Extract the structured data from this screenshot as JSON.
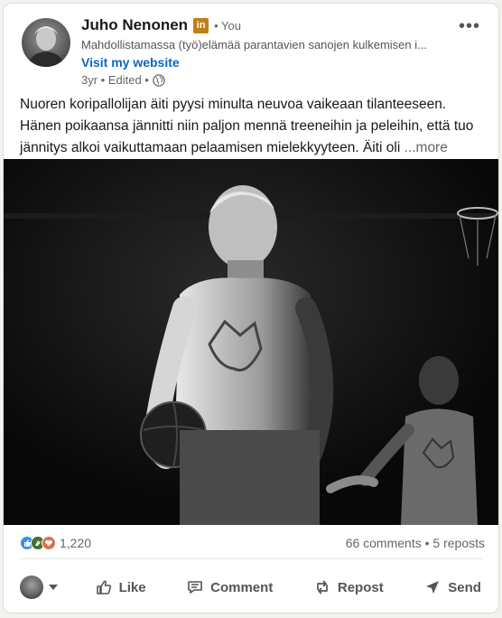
{
  "author": {
    "name": "Juho Nenonen",
    "badge": "in",
    "you_label": "• You",
    "headline": "Mahdollistamassa (työ)elämää parantavien sanojen kulkemisen i...",
    "website_label": "Visit my website",
    "meta": "3yr • Edited •"
  },
  "post": {
    "text": "Nuoren koripallolijan äiti pyysi minulta neuvoa vaikeaan tilanteeseen. Hänen poikaansa jännitti niin paljon mennä treeneihin ja peleihin, että tuo jännitys alkoi vaikuttamaan pelaamisen mielekkyyteen. Äiti oli",
    "see_more": "...more"
  },
  "social": {
    "reaction_count": "1,220",
    "comments_reposts": "66 comments • 5 reposts"
  },
  "actions": {
    "like": "Like",
    "comment": "Comment",
    "repost": "Repost",
    "send": "Send"
  },
  "icons": {
    "menu": "more-horizontal-icon",
    "visibility": "globe-icon",
    "like": "thumbs-up-icon",
    "comment": "comment-icon",
    "repost": "repost-icon",
    "send": "send-icon"
  },
  "colors": {
    "link": "#0a66c2",
    "badge": "#c37d16",
    "like_reaction": "#378fe9",
    "clap_reaction": "#44712e",
    "love_reaction": "#df704d"
  }
}
